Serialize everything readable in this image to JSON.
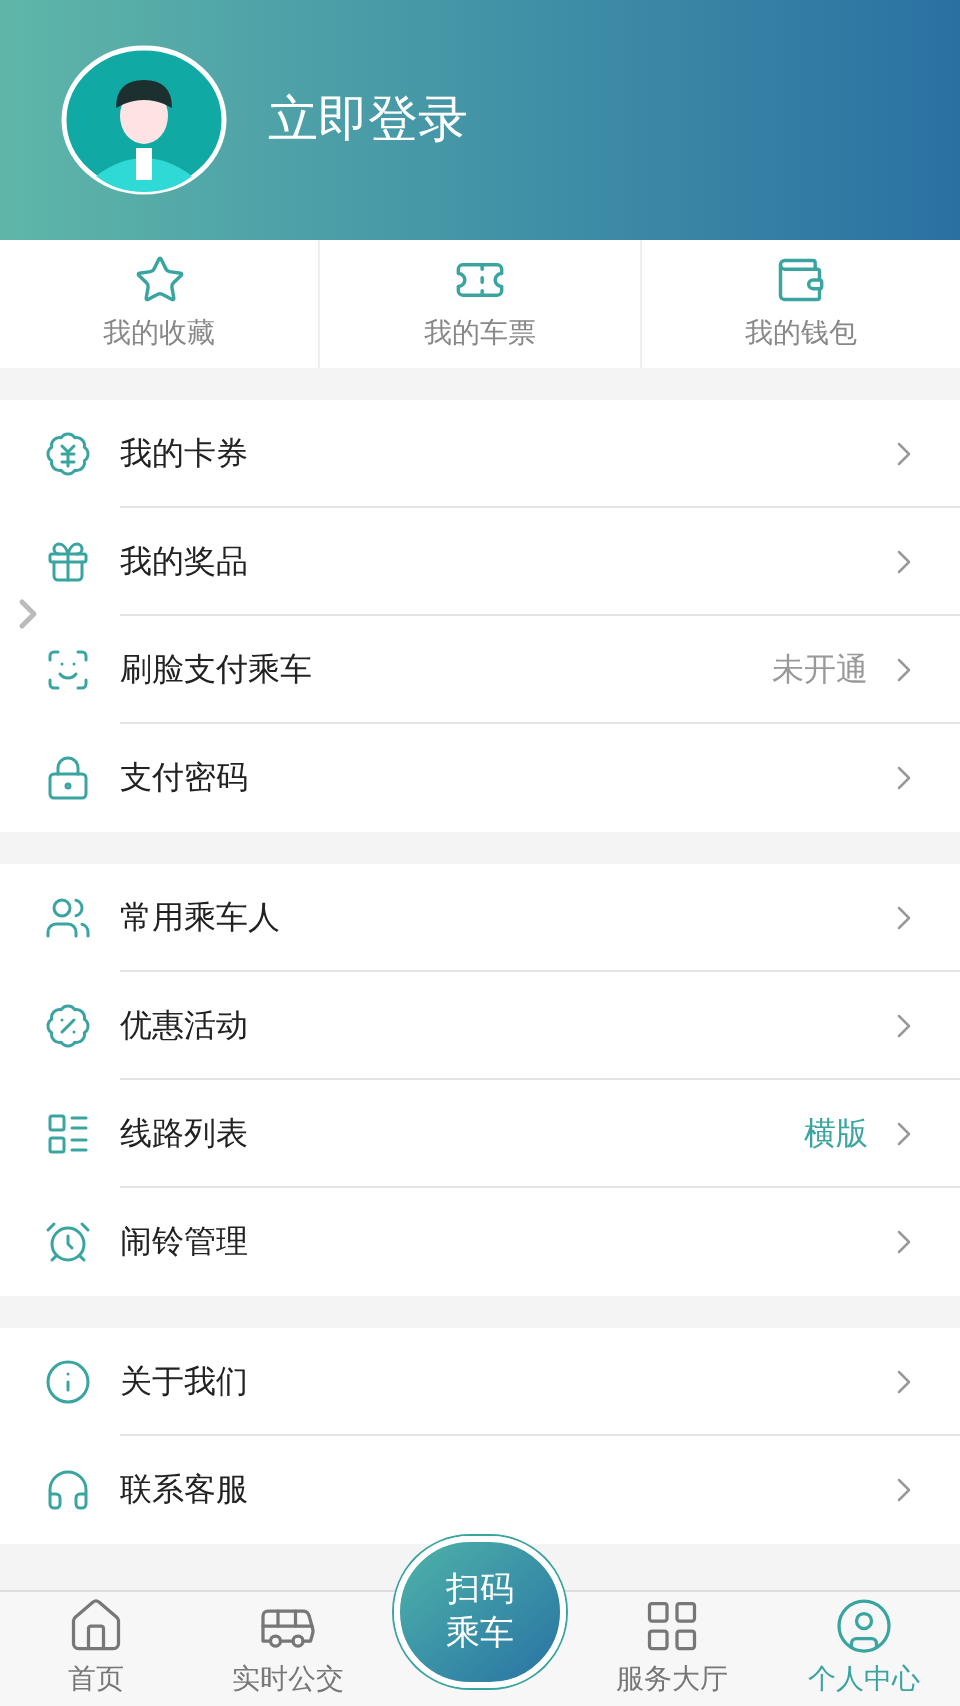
{
  "header": {
    "login_label": "立即登录"
  },
  "shortcuts": [
    {
      "label": "我的收藏"
    },
    {
      "label": "我的车票"
    },
    {
      "label": "我的钱包"
    }
  ],
  "menu_groups": [
    {
      "items": [
        {
          "label": "我的卡券"
        },
        {
          "label": "我的奖品"
        },
        {
          "label": "刷脸支付乘车",
          "value": "未开通",
          "color": "#999999"
        },
        {
          "label": "支付密码"
        }
      ]
    },
    {
      "items": [
        {
          "label": "常用乘车人"
        },
        {
          "label": "优惠活动"
        },
        {
          "label": "线路列表",
          "value": "横版",
          "color": "#3aa5a0"
        },
        {
          "label": "闹铃管理"
        }
      ]
    },
    {
      "items": [
        {
          "label": "关于我们"
        },
        {
          "label": "联系客服"
        }
      ]
    }
  ],
  "tab_bar": {
    "tabs": [
      {
        "label": "首页",
        "selected": false
      },
      {
        "label": "实时公交",
        "selected": false
      },
      {
        "label": "服务大厅",
        "selected": false
      },
      {
        "label": "个人中心",
        "selected": true
      }
    ],
    "scan_button": {
      "label": "扫码乘车"
    }
  }
}
